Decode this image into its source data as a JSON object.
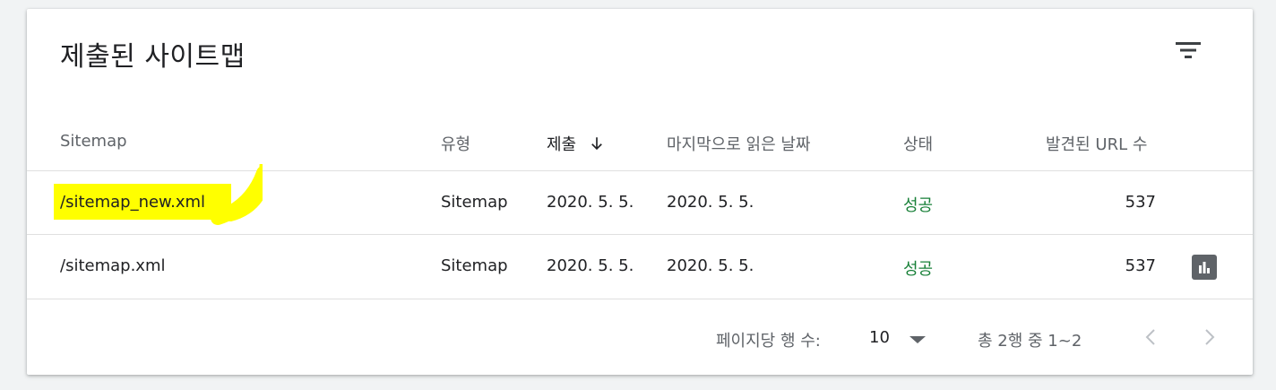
{
  "card": {
    "title": "제출된 사이트맵",
    "filter_icon": "filter-list-icon"
  },
  "table": {
    "columns": {
      "sitemap": "Sitemap",
      "type": "유형",
      "submitted": "제출",
      "last_read": "마지막으로 읽은 날짜",
      "status": "상태",
      "discovered_urls": "발견된 URL 수"
    },
    "sort_icon": "arrow-downward-icon",
    "rows": [
      {
        "sitemap": "/sitemap_new.xml",
        "type": "Sitemap",
        "submitted": "2020. 5. 5.",
        "last_read": "2020. 5. 5.",
        "status": "성공",
        "discovered_urls": "537",
        "highlighted": true
      },
      {
        "sitemap": "/sitemap.xml",
        "type": "Sitemap",
        "submitted": "2020. 5. 5.",
        "last_read": "2020. 5. 5.",
        "status": "성공",
        "discovered_urls": "537",
        "report_icon": "bar-chart-icon"
      }
    ]
  },
  "pagination": {
    "rows_per_page_label": "페이지당 행 수:",
    "rows_per_page_value": "10",
    "range_label": "총 2행 중 1~2",
    "prev_icon": "chevron-left-icon",
    "next_icon": "chevron-right-icon"
  },
  "colors": {
    "status_success": "#188038",
    "highlight": "#ffff00",
    "text_primary": "#202124",
    "text_secondary": "#5f6368"
  }
}
